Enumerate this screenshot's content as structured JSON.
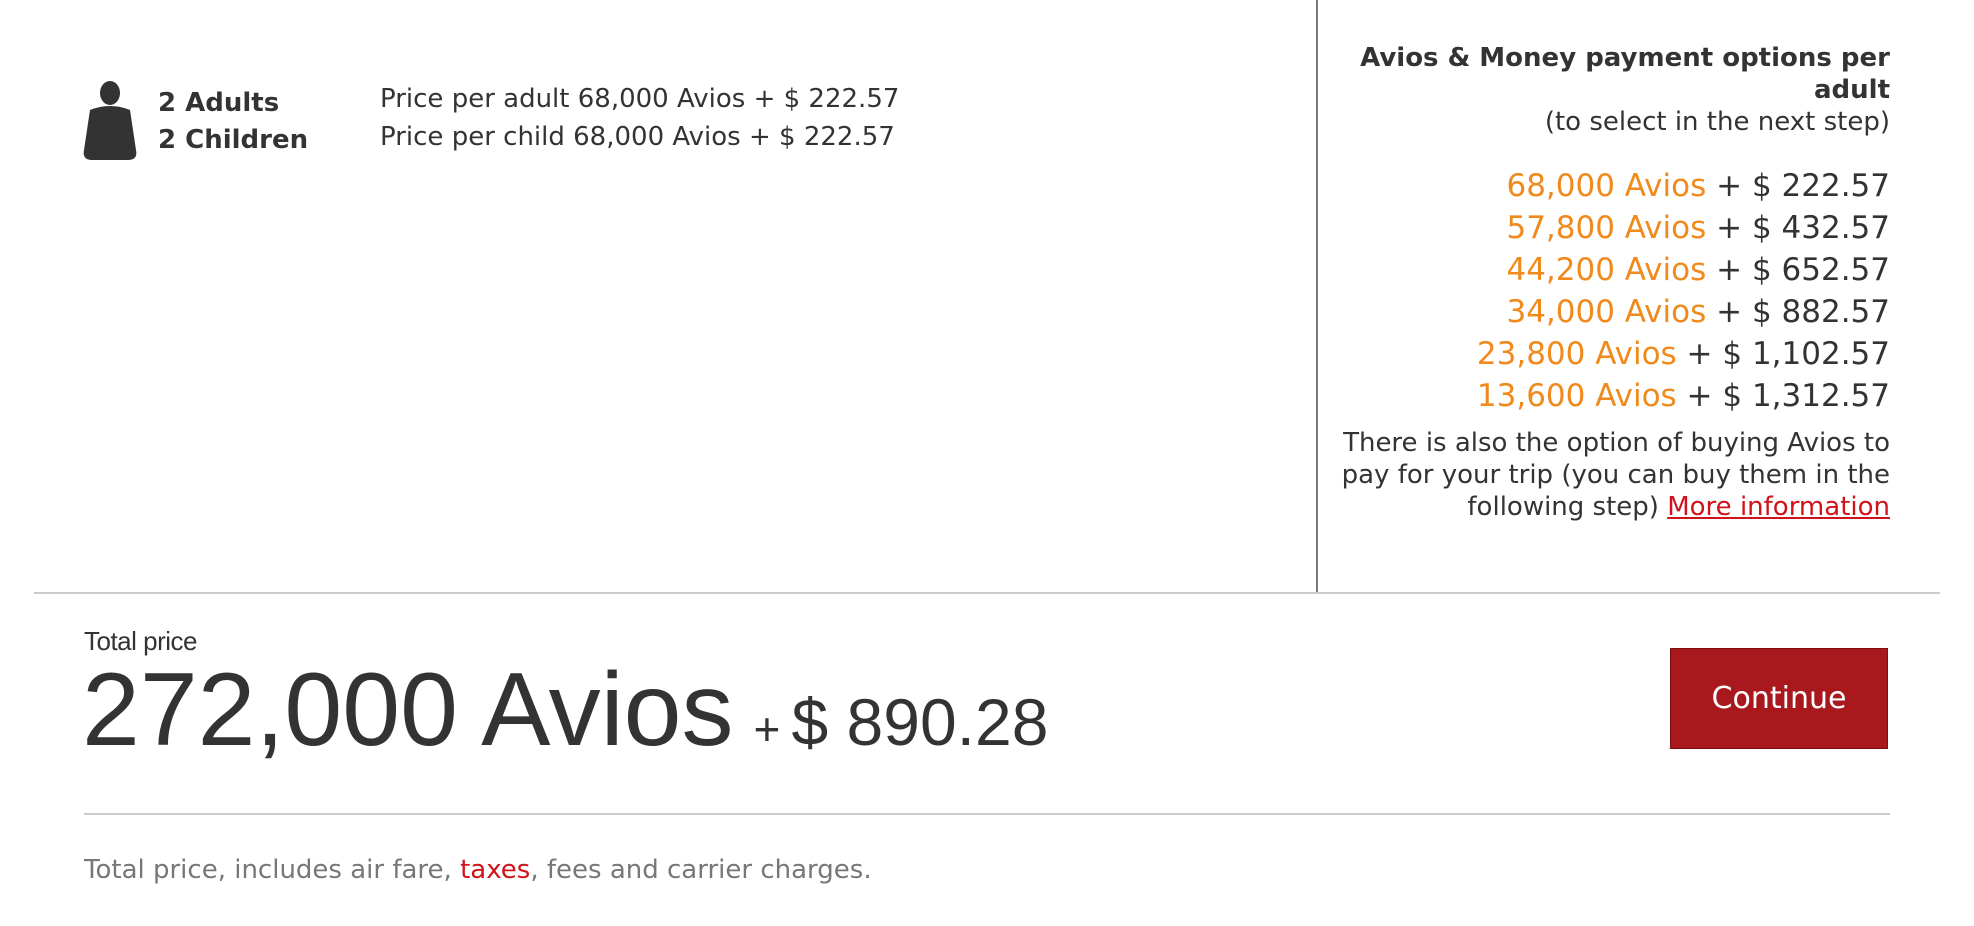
{
  "passengers": {
    "adults_label": "2 Adults",
    "children_label": "2 Children",
    "price_per_adult": "Price per adult 68,000 Avios + $ 222.57",
    "price_per_child": "Price per child 68,000 Avios + $ 222.57",
    "icon": "person-icon"
  },
  "payment_options": {
    "title": "Avios & Money payment options per adult",
    "subtitle": "(to select in the next step)",
    "options": [
      {
        "avios": "68,000 Avios",
        "money": " + $ 222.57"
      },
      {
        "avios": "57,800 Avios",
        "money": " + $ 432.57"
      },
      {
        "avios": "44,200 Avios",
        "money": " + $ 652.57"
      },
      {
        "avios": "34,000 Avios",
        "money": " + $ 882.57"
      },
      {
        "avios": "23,800 Avios",
        "money": " + $ 1,102.57"
      },
      {
        "avios": "13,600 Avios",
        "money": " + $ 1,312.57"
      }
    ],
    "buy_note": "There is also the option of buying Avios to pay for your trip (you can buy them in the following step)",
    "more_info_link": "More information"
  },
  "total": {
    "label": "Total price",
    "avios": "272,000 Avios",
    "plus": "+",
    "money": "$ 890.28"
  },
  "continue_button": "Continue",
  "footnote": {
    "before": "Total price, includes air fare, ",
    "taxes_link": "taxes",
    "after": ", fees and carrier charges."
  },
  "colors": {
    "avios_orange": "#f08a1c",
    "link_red": "#d0121b",
    "button_red": "#a8181d",
    "text_dark": "#333333",
    "text_muted": "#777777"
  }
}
